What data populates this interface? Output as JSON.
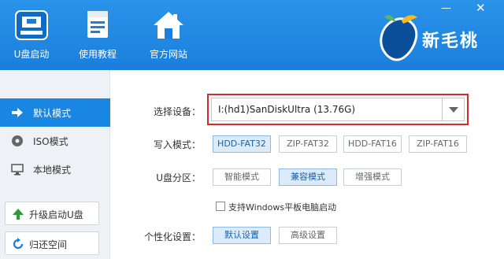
{
  "window": {
    "minimize_glyph": "—",
    "close_glyph": "✕"
  },
  "nav": {
    "items": [
      {
        "label": "U盘启动",
        "icon": "usb-drive-icon",
        "active": true
      },
      {
        "label": "使用教程",
        "icon": "document-icon"
      },
      {
        "label": "官方网站",
        "icon": "home-icon"
      }
    ]
  },
  "brand": {
    "name": "新毛桃",
    "logo": "peach-logo-icon"
  },
  "sidebar": {
    "items": [
      {
        "label": "默认模式",
        "icon": "arrow-right-icon",
        "active": true
      },
      {
        "label": "ISO模式",
        "icon": "disc-icon"
      },
      {
        "label": "本地模式",
        "icon": "monitor-icon"
      }
    ],
    "buttons": [
      {
        "label": "升级启动U盘",
        "icon": "upgrade-arrow-icon"
      },
      {
        "label": "归还空间",
        "icon": "restore-icon"
      }
    ]
  },
  "main": {
    "device": {
      "label": "选择设备：",
      "value": "I:(hd1)SanDiskUltra (13.76G)"
    },
    "write_mode": {
      "label": "写入模式：",
      "options": [
        "HDD-FAT32",
        "ZIP-FAT32",
        "HDD-FAT16",
        "ZIP-FAT16"
      ],
      "selected": "HDD-FAT32"
    },
    "partition": {
      "label": "U盘分区：",
      "options": [
        "智能模式",
        "兼容模式",
        "增强模式"
      ],
      "selected": "兼容模式"
    },
    "tablet_support": {
      "label": "支持Windows平板电脑启动",
      "checked": false
    },
    "personalize": {
      "label": "个性化设置：",
      "options": [
        "默认设置",
        "高级设置"
      ],
      "selected": "默认设置"
    }
  },
  "colors": {
    "header": "#1a86e3",
    "accent": "#1a86e3",
    "highlight_border": "#d62b2b"
  }
}
